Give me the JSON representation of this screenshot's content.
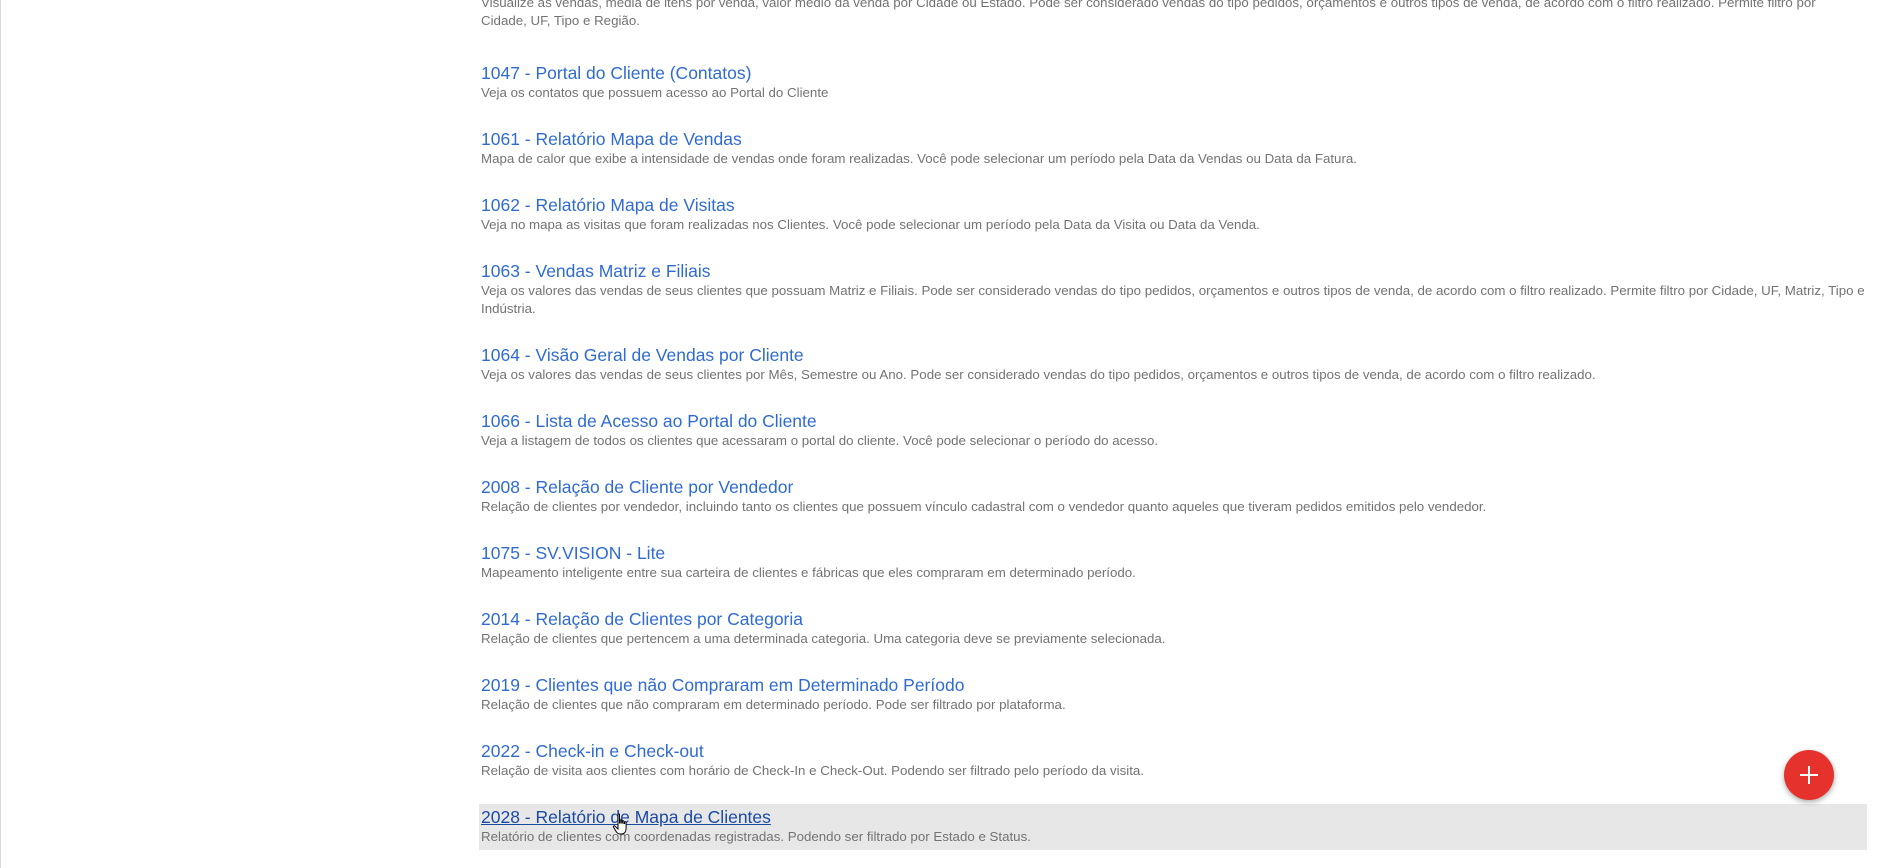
{
  "reports": [
    {
      "title": "",
      "description": "Visualize as vendas, média de itens por venda, valor médio da venda por Cidade ou Estado. Pode ser considerado vendas do tipo pedidos, orçamentos e outros tipos de venda, de acordo com o filtro realizado. Permite filtro por Cidade, UF, Tipo e Região."
    },
    {
      "title": "1047 - Portal do Cliente (Contatos)",
      "description": "Veja os contatos que possuem acesso ao Portal do Cliente"
    },
    {
      "title": "1061 - Relatório Mapa de Vendas",
      "description": "Mapa de calor que exibe a intensidade de vendas onde foram realizadas. Você pode selecionar um período pela Data da Vendas ou Data da Fatura."
    },
    {
      "title": "1062 - Relatório Mapa de Visitas",
      "description": "Veja no mapa as visitas que foram realizadas nos Clientes. Você pode selecionar um período pela Data da Visita ou Data da Venda."
    },
    {
      "title": "1063 - Vendas Matriz e Filiais",
      "description": "Veja os valores das vendas de seus clientes que possuam Matriz e Filiais. Pode ser considerado vendas do tipo pedidos, orçamentos e outros tipos de venda, de acordo com o filtro realizado. Permite filtro por Cidade, UF, Matriz, Tipo e Indústria."
    },
    {
      "title": "1064 - Visão Geral de Vendas por Cliente",
      "description": "Veja os valores das vendas de seus clientes por Mês, Semestre ou Ano. Pode ser considerado vendas do tipo pedidos, orçamentos e outros tipos de venda, de acordo com o filtro realizado."
    },
    {
      "title": "1066 - Lista de Acesso ao Portal do Cliente",
      "description": "Veja a listagem de todos os clientes que acessaram o portal do cliente. Você pode selecionar o período do acesso."
    },
    {
      "title": "2008 - Relação de Cliente por Vendedor",
      "description": "Relação de clientes por vendedor, incluindo tanto os clientes que possuem vínculo cadastral com o vendedor quanto aqueles que tiveram pedidos emitidos pelo vendedor."
    },
    {
      "title": "1075 - SV.VISION - Lite",
      "description": "Mapeamento inteligente entre sua carteira de clientes e fábricas que eles compraram em determinado período."
    },
    {
      "title": "2014 - Relação de Clientes por Categoria",
      "description": "Relação de clientes que pertencem a uma determinada categoria. Uma categoria deve se previamente selecionada."
    },
    {
      "title": "2019 - Clientes que não Compraram em Determinado Período",
      "description": "Relação de clientes que não compraram em determinado período. Pode ser filtrado por plataforma."
    },
    {
      "title": "2022 - Check-in e Check-out",
      "description": "Relação de visita aos clientes com horário de Check-In e Check-Out. Podendo ser filtrado pelo período da visita."
    },
    {
      "title": "2028 - Relatório de Mapa de Clientes",
      "description": "Relatório de clientes com coordenadas registradas. Podendo ser filtrado por Estado e Status."
    }
  ],
  "fab": {
    "icon": "plus-icon",
    "color": "#e5322d"
  },
  "colors": {
    "link": "#2f6bd3",
    "description": "#737373",
    "hover_bg": "#e7e7e7"
  }
}
